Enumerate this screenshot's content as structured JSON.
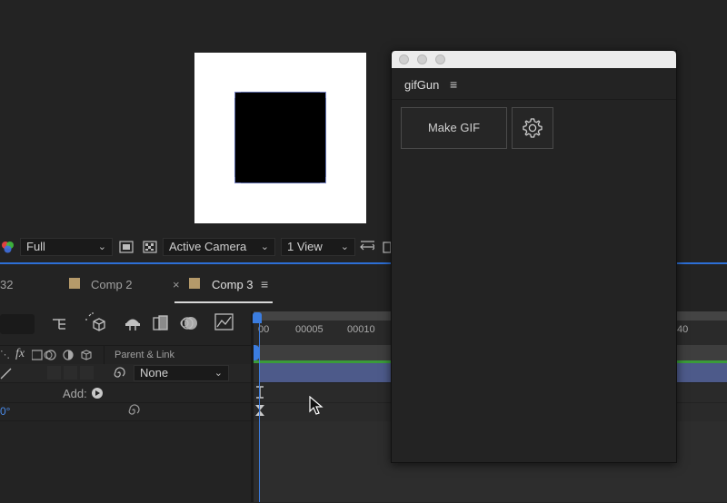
{
  "viewer_toolbar": {
    "resolution": "Full",
    "camera": "Active Camera",
    "views": "1 View"
  },
  "tabs": {
    "partial": "32",
    "comp2": "Comp 2",
    "close_glyph": "×",
    "comp3": "Comp 3",
    "menu_glyph": "≡"
  },
  "ruler": {
    "ticks": [
      "00",
      "00005",
      "00010",
      "40"
    ]
  },
  "columns": {
    "fx": "fx",
    "parent_link": "Parent & Link"
  },
  "layer": {
    "parent_value": "None"
  },
  "add_row": {
    "label": "Add:"
  },
  "rotation_row": {
    "value_partial": "0°"
  },
  "plugin": {
    "title": "gifGun",
    "menu_glyph": "≡",
    "make_gif_label": "Make GIF"
  },
  "colors": {
    "accent_blue": "#2d6fd6",
    "layer_bar": "#4d5a8a",
    "swatch_tan": "#b59a6a",
    "green_track": "#3a9b3a"
  },
  "icons": [
    "rgb-channels-icon",
    "region-icon",
    "transparency-grid-icon",
    "fast-previews-icon",
    "draft-3d-icon",
    "motion-blur-icon",
    "graph-editor-icon",
    "gear-icon",
    "ibeam-icon",
    "cursor-arrow-icon",
    "parent-pickwhip-icon"
  ]
}
